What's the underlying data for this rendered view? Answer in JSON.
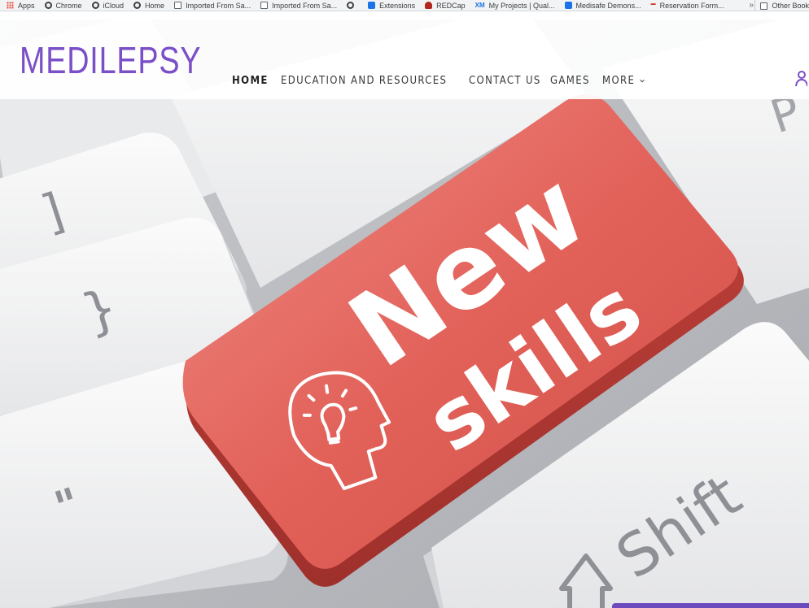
{
  "bookmarks": {
    "items": [
      {
        "label": "Apps",
        "icon": "apps-grid-icon"
      },
      {
        "label": "Chrome",
        "icon": "globe-icon"
      },
      {
        "label": "iCloud",
        "icon": "cloud-icon"
      },
      {
        "label": "Home",
        "icon": "globe-icon"
      },
      {
        "label": "Imported From Sa...",
        "icon": "folder-icon"
      },
      {
        "label": "Imported From Sa...",
        "icon": "folder-icon"
      },
      {
        "label": "",
        "icon": "globe-icon"
      },
      {
        "label": "Extensions",
        "icon": "puzzle-icon"
      },
      {
        "label": "REDCap",
        "icon": "redcap-icon"
      },
      {
        "label": "My Projects | Qual...",
        "icon": "xm-icon"
      },
      {
        "label": "Medisafe Demons...",
        "icon": "medisafe-icon"
      },
      {
        "label": "Reservation Form...",
        "icon": "reservation-icon"
      }
    ],
    "overflow": "»",
    "other": "Other Book"
  },
  "site": {
    "logo": "MEDILEPSY",
    "nav": {
      "home": "HOME",
      "education": "EDUCATION AND RESOURCES",
      "contact": "CONTACT US",
      "games": "GAMES",
      "more": "MORE"
    }
  },
  "hero": {
    "key_text_line1": "New",
    "key_text_line2": "skills",
    "key_bracket": "]",
    "key_brace": "}",
    "key_quote": "\"",
    "key_shift": "Shift",
    "key_p": "P",
    "colors": {
      "red_key": "#e2625a",
      "keycap": "#f4f4f4",
      "accent": "#7a4fc7"
    }
  }
}
